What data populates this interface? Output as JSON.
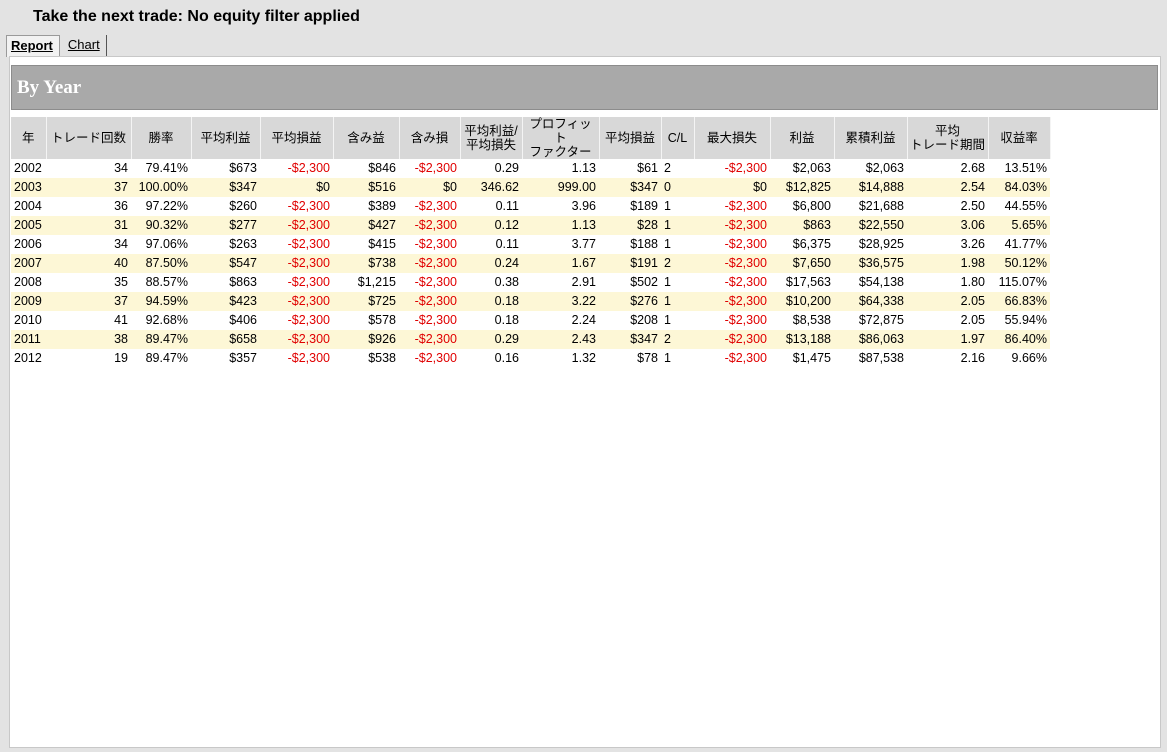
{
  "window": {
    "title": "Take the next trade: No equity filter applied"
  },
  "tabs": [
    {
      "label": "Report",
      "active": true
    },
    {
      "label": "Chart",
      "active": false
    }
  ],
  "section": {
    "title": "By Year"
  },
  "colors": {
    "negative": "#e00000",
    "alt_row": "#fdf7d6",
    "header_bg": "#d8d8d8",
    "section_bg": "#a9a9a9"
  },
  "table": {
    "headers": [
      "年",
      "トレード回数",
      "勝率",
      "平均利益",
      "平均損益",
      "含み益",
      "含み損",
      "平均利益/\n平均損失",
      "プロフィット\nファクター",
      "平均損益",
      "C/L",
      "最大損失",
      "利益",
      "累積利益",
      "平均\nトレード期間",
      "収益率"
    ],
    "rows": [
      [
        "2002",
        "34",
        "79.41%",
        "$673",
        "-$2,300",
        "$846",
        "-$2,300",
        "0.29",
        "1.13",
        "$61",
        "2",
        "-$2,300",
        "$2,063",
        "$2,063",
        "2.68",
        "13.51%"
      ],
      [
        "2003",
        "37",
        "100.00%",
        "$347",
        "$0",
        "$516",
        "$0",
        "346.62",
        "999.00",
        "$347",
        "0",
        "$0",
        "$12,825",
        "$14,888",
        "2.54",
        "84.03%"
      ],
      [
        "2004",
        "36",
        "97.22%",
        "$260",
        "-$2,300",
        "$389",
        "-$2,300",
        "0.11",
        "3.96",
        "$189",
        "1",
        "-$2,300",
        "$6,800",
        "$21,688",
        "2.50",
        "44.55%"
      ],
      [
        "2005",
        "31",
        "90.32%",
        "$277",
        "-$2,300",
        "$427",
        "-$2,300",
        "0.12",
        "1.13",
        "$28",
        "1",
        "-$2,300",
        "$863",
        "$22,550",
        "3.06",
        "5.65%"
      ],
      [
        "2006",
        "34",
        "97.06%",
        "$263",
        "-$2,300",
        "$415",
        "-$2,300",
        "0.11",
        "3.77",
        "$188",
        "1",
        "-$2,300",
        "$6,375",
        "$28,925",
        "3.26",
        "41.77%"
      ],
      [
        "2007",
        "40",
        "87.50%",
        "$547",
        "-$2,300",
        "$738",
        "-$2,300",
        "0.24",
        "1.67",
        "$191",
        "2",
        "-$2,300",
        "$7,650",
        "$36,575",
        "1.98",
        "50.12%"
      ],
      [
        "2008",
        "35",
        "88.57%",
        "$863",
        "-$2,300",
        "$1,215",
        "-$2,300",
        "0.38",
        "2.91",
        "$502",
        "1",
        "-$2,300",
        "$17,563",
        "$54,138",
        "1.80",
        "115.07%"
      ],
      [
        "2009",
        "37",
        "94.59%",
        "$423",
        "-$2,300",
        "$725",
        "-$2,300",
        "0.18",
        "3.22",
        "$276",
        "1",
        "-$2,300",
        "$10,200",
        "$64,338",
        "2.05",
        "66.83%"
      ],
      [
        "2010",
        "41",
        "92.68%",
        "$406",
        "-$2,300",
        "$578",
        "-$2,300",
        "0.18",
        "2.24",
        "$208",
        "1",
        "-$2,300",
        "$8,538",
        "$72,875",
        "2.05",
        "55.94%"
      ],
      [
        "2011",
        "38",
        "89.47%",
        "$658",
        "-$2,300",
        "$926",
        "-$2,300",
        "0.29",
        "2.43",
        "$347",
        "2",
        "-$2,300",
        "$13,188",
        "$86,063",
        "1.97",
        "86.40%"
      ],
      [
        "2012",
        "19",
        "89.47%",
        "$357",
        "-$2,300",
        "$538",
        "-$2,300",
        "0.16",
        "1.32",
        "$78",
        "1",
        "-$2,300",
        "$1,475",
        "$87,538",
        "2.16",
        "9.66%"
      ]
    ]
  }
}
